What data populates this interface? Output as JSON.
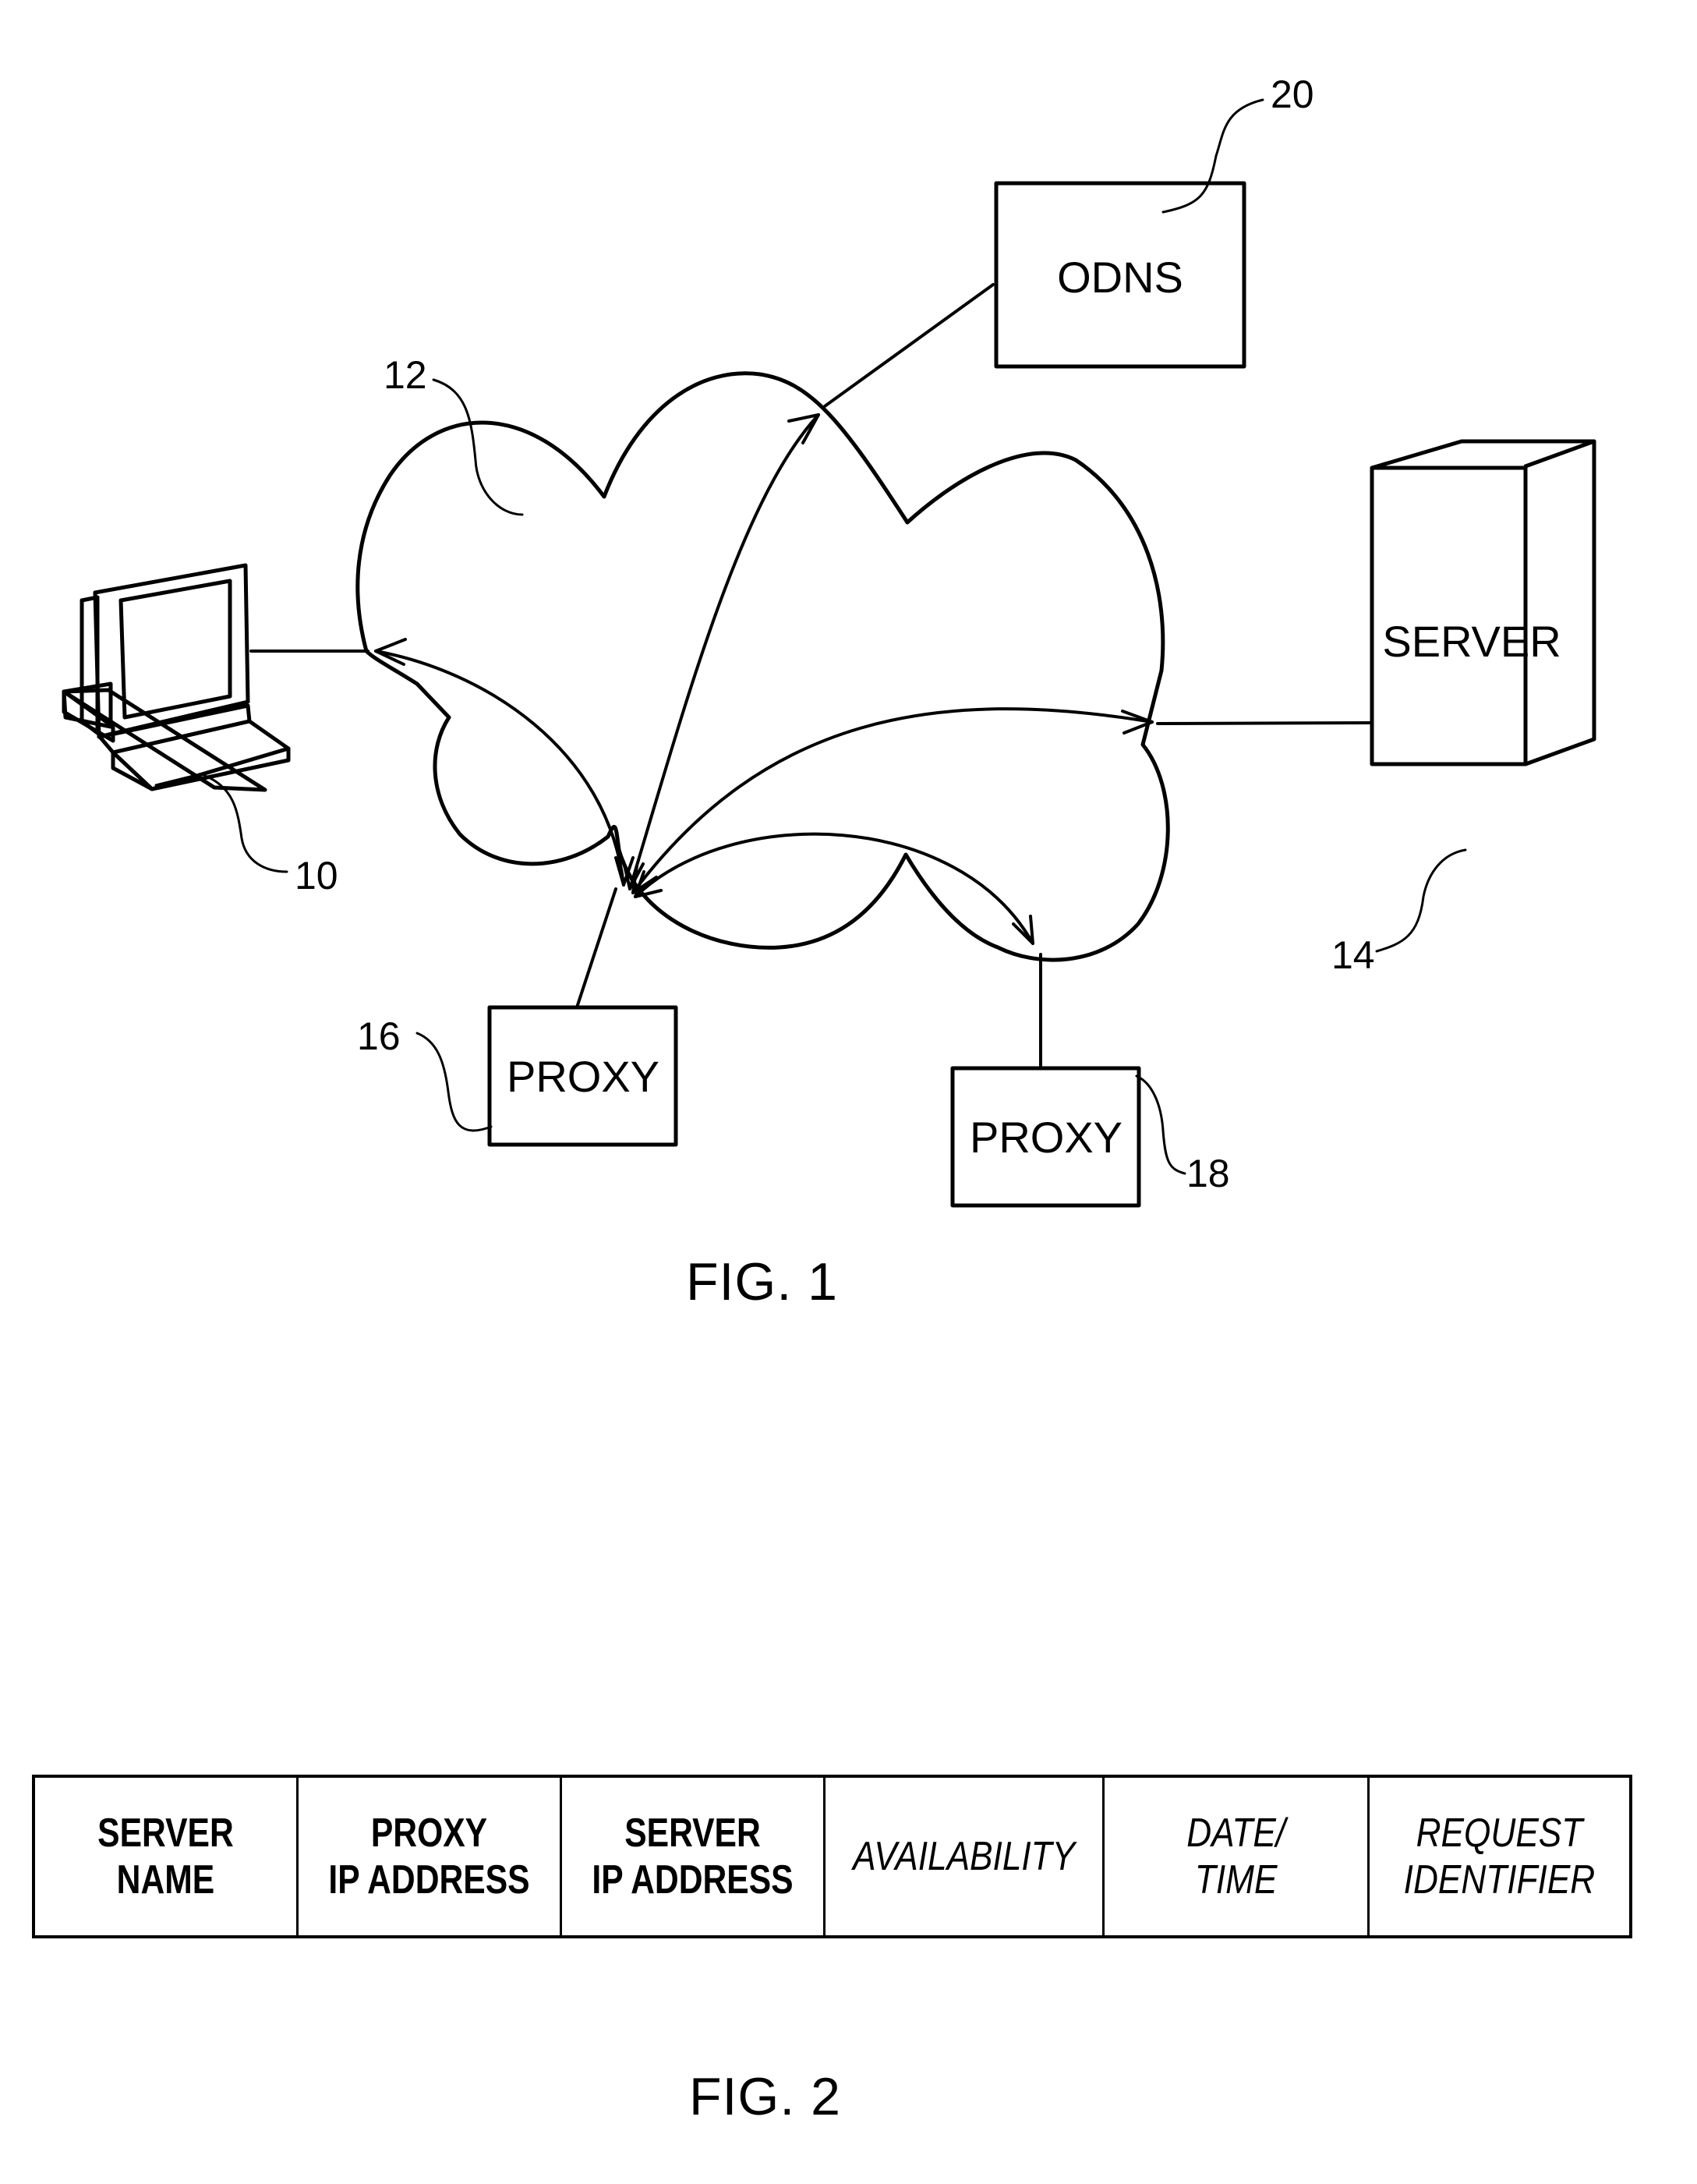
{
  "figure1": {
    "caption": "FIG. 1",
    "nodes": {
      "client": {
        "ref": "10",
        "icon": "desktop-computer-icon"
      },
      "network": {
        "ref": "12",
        "icon": "cloud-icon"
      },
      "server": {
        "ref": "14",
        "label": "SERVER"
      },
      "proxy_a": {
        "ref": "16",
        "label": "PROXY"
      },
      "proxy_b": {
        "ref": "18",
        "label": "PROXY"
      },
      "odns": {
        "ref": "20",
        "label": "ODNS"
      }
    },
    "connections": [
      {
        "from": "client",
        "to": "proxy_a",
        "type": "bidirectional-arrow"
      },
      {
        "from": "odns",
        "to": "proxy_a",
        "type": "bidirectional-arrow"
      },
      {
        "from": "server",
        "to": "proxy_a",
        "type": "bidirectional-arrow"
      },
      {
        "from": "proxy_b",
        "to": "proxy_a",
        "type": "bidirectional-arrow"
      }
    ]
  },
  "figure2": {
    "caption": "FIG. 2",
    "columns": [
      {
        "label": "SERVER\nNAME",
        "style": "bold"
      },
      {
        "label": "PROXY\nIP ADDRESS",
        "style": "bold"
      },
      {
        "label": "SERVER\nIP ADDRESS",
        "style": "bold"
      },
      {
        "label": "AVAILABILITY",
        "style": "italic"
      },
      {
        "label": "DATE/\nTIME",
        "style": "italic"
      },
      {
        "label": "REQUEST\nIDENTIFIER",
        "style": "italic"
      }
    ]
  }
}
